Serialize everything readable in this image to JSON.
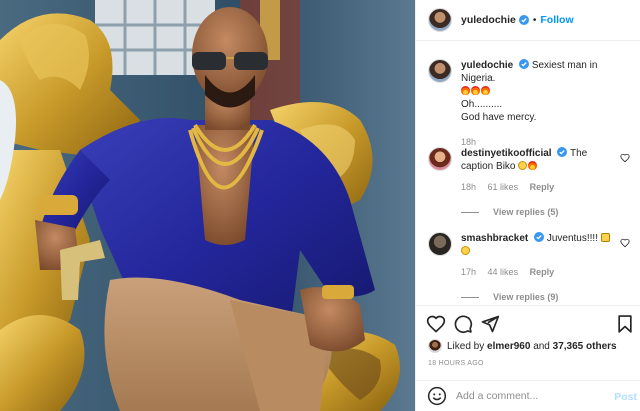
{
  "post": {
    "author": "yuledochie",
    "follow_label": "Follow",
    "separator": "•"
  },
  "caption": {
    "username": "yuledochie",
    "line1": "Sexiest man in Nigeria.",
    "line2": "Oh..........",
    "line3": "God have mercy.",
    "time": "18h"
  },
  "comments": [
    {
      "username": "destinyetikoofficial",
      "text": "The caption Biko",
      "time": "18h",
      "likes": "61 likes",
      "reply_label": "Reply",
      "view_replies": "View replies (5)"
    },
    {
      "username": "smashbracket",
      "text": "Juventus!!!!",
      "time": "17h",
      "likes": "44 likes",
      "reply_label": "Reply",
      "view_replies": "View replies (9)"
    }
  ],
  "likes": {
    "prefix": "Liked by",
    "user": "elmer960",
    "and": "and",
    "others": "37,365 others"
  },
  "timestamp": "18 HOURS AGO",
  "add_comment": {
    "placeholder": "Add a comment...",
    "post_label": "Post"
  },
  "colors": {
    "link_blue": "#0095f6",
    "verified_blue": "#3897f0",
    "muted": "#8e8e8e"
  }
}
